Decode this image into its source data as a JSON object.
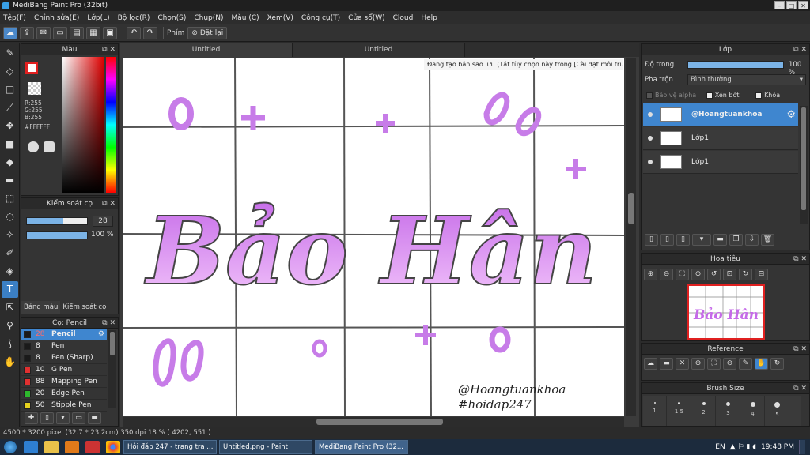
{
  "window": {
    "title": "MediBang Paint Pro (32bit)"
  },
  "menu": [
    "Tệp(F)",
    "Chỉnh sửa(E)",
    "Lớp(L)",
    "Bộ lọc(R)",
    "Chọn(S)",
    "Chụp(N)",
    "Màu (C)",
    "Xem(V)",
    "Công cụ(T)",
    "Cửa sổ(W)",
    "Cloud",
    "Help"
  ],
  "toolbar": {
    "key_label": "Phím",
    "reset_label": "Đặt lại"
  },
  "color_panel": {
    "title": "Màu",
    "r": "R:255",
    "g": "G:255",
    "b": "B:255",
    "hex": "#FFFFFF"
  },
  "brush_control": {
    "title": "Kiểm soát cọ",
    "size": "28",
    "opacity": "100 %",
    "size_fraction": 0.6,
    "opacity_fraction": 1.0
  },
  "left_tabs": {
    "color": "Bảng màu",
    "brush": "Kiểm soát cọ"
  },
  "brush_panel": {
    "title": "Cọ: Pencil",
    "items": [
      {
        "num": "28",
        "name": "Pencil",
        "color": "#1a1a1a",
        "selected": true
      },
      {
        "num": "8",
        "name": "Pen",
        "color": "#1a1a1a"
      },
      {
        "num": "8",
        "name": "Pen (Sharp)",
        "color": "#1a1a1a"
      },
      {
        "num": "10",
        "name": "G Pen",
        "color": "#e03030"
      },
      {
        "num": "88",
        "name": "Mapping Pen",
        "color": "#e03030"
      },
      {
        "num": "20",
        "name": "Edge Pen",
        "color": "#2db82d"
      },
      {
        "num": "50",
        "name": "Stipple Pen",
        "color": "#e6d11e"
      }
    ]
  },
  "tabs": [
    "Untitled",
    "Untitled"
  ],
  "notice": "Đang tạo bản sao lưu (Tắt tùy chọn này trong [Cài đặt môi trường])",
  "canvas": {
    "title_text": "Bảo Hân",
    "credit1": "@Hoangtuankhoa",
    "credit2": "#hoidap247"
  },
  "layer_panel": {
    "title": "Lớp",
    "opacity_label": "Độ trong",
    "opacity": "100 %",
    "opacity_fraction": 1.0,
    "blend_label": "Pha trộn",
    "blend": "Bình thường",
    "protect_alpha": "Bảo vệ alpha",
    "clip": "Xén bớt",
    "lock": "Khóa",
    "layers": [
      {
        "name": "@Hoangtuankhoa",
        "selected": true
      },
      {
        "name": "Lớp1"
      },
      {
        "name": "Lớp1"
      }
    ]
  },
  "navigator": {
    "title": "Hoa tiêu"
  },
  "reference": {
    "title": "Reference"
  },
  "brush_size": {
    "title": "Brush Size",
    "sizes": [
      "1",
      "1.5",
      "2",
      "3",
      "4",
      "5"
    ]
  },
  "status": "4500 * 3200 pixel  (32.7 * 23.2cm)  350 dpi  18 %  ( 4202, 551 )",
  "taskbar": {
    "items": [
      "Hỏi đáp 247 - trang tra ...",
      "Untitled.png - Paint",
      "MediBang Paint Pro (32..."
    ],
    "lang": "EN",
    "time": "19:48 PM"
  }
}
